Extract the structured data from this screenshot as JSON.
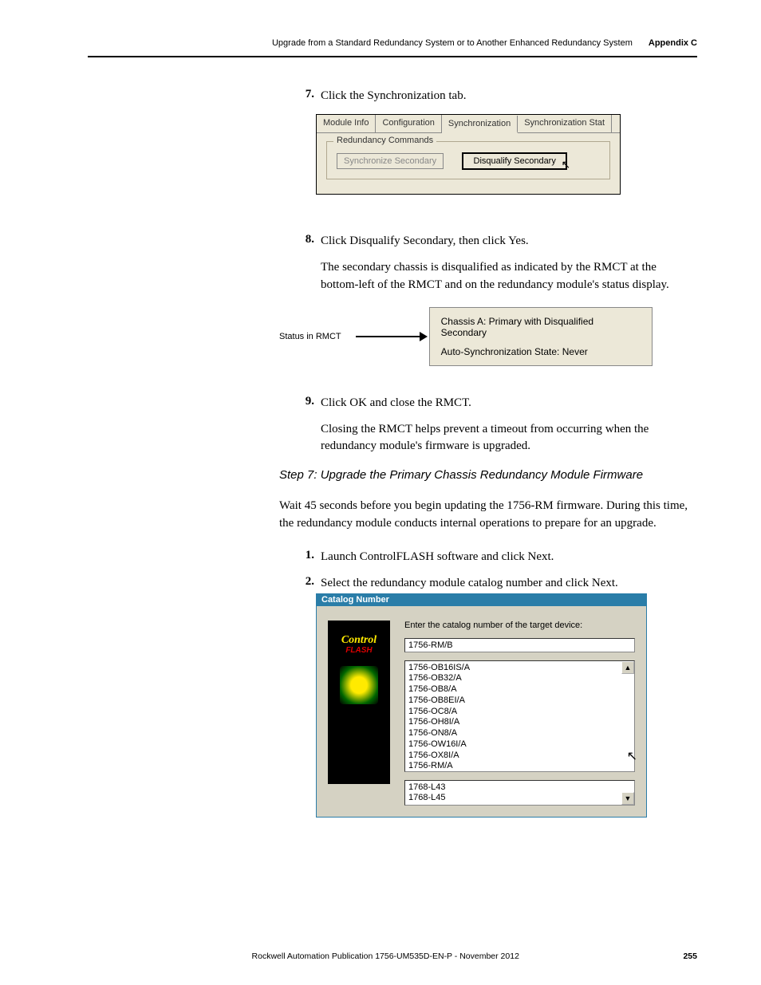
{
  "header": {
    "chapter_text": "Upgrade from a Standard Redundancy System or to Another Enhanced Redundancy System",
    "appendix": "Appendix C"
  },
  "step7": {
    "num": "7.",
    "text": "Click the Synchronization tab."
  },
  "tabpanel": {
    "tab1": "Module Info",
    "tab2": "Configuration",
    "tab3": "Synchronization",
    "tab4": "Synchronization Stat",
    "fieldset_legend": "Redundancy Commands",
    "btn_sync": "Synchronize Secondary",
    "btn_disq": "Disqualify Secondary"
  },
  "step8": {
    "num": "8.",
    "text": "Click Disqualify Secondary, then click Yes.",
    "para": "The secondary chassis is disqualified as indicated by the RMCT at the bottom-left of the RMCT and on the redundancy module's status display."
  },
  "status": {
    "label": "Status in RMCT",
    "line1": "Chassis A: Primary with Disqualified Secondary",
    "line2": "Auto-Synchronization State:  Never"
  },
  "step9": {
    "num": "9.",
    "text": "Click OK and close the RMCT.",
    "para": "Closing the RMCT helps prevent a timeout from occurring when the redundancy module's firmware is upgraded."
  },
  "step7heading": "Step 7: Upgrade the Primary Chassis Redundancy Module Firmware",
  "step7para": "Wait 45 seconds before you begin updating the 1756-RM firmware. During this time, the redundancy module conducts internal operations to prepare for an upgrade.",
  "step_s1": {
    "num": "1.",
    "text": "Launch ControlFLASH software and click Next."
  },
  "step_s2": {
    "num": "2.",
    "text": "Select the redundancy module catalog number and click Next."
  },
  "catalog": {
    "title": "Catalog Number",
    "prompt": "Enter the catalog number of the target device:",
    "input_value": "1756-RM/B",
    "logo_main": "Control",
    "logo_sub": "FLASH",
    "items": {
      "i0": "1756-OB16IS/A",
      "i1": "1756-OB32/A",
      "i2": "1756-OB8/A",
      "i3": "1756-OB8EI/A",
      "i4": "1756-OC8/A",
      "i5": "1756-OH8I/A",
      "i6": "1756-ON8/A",
      "i7": "1756-OW16I/A",
      "i8": "1756-OX8I/A",
      "i9": "1756-RM/A"
    },
    "bottom": {
      "b0": "1768-L43",
      "b1": "1768-L45"
    }
  },
  "footer": {
    "pub": "Rockwell Automation Publication 1756-UM535D-EN-P - November 2012",
    "page": "255"
  }
}
